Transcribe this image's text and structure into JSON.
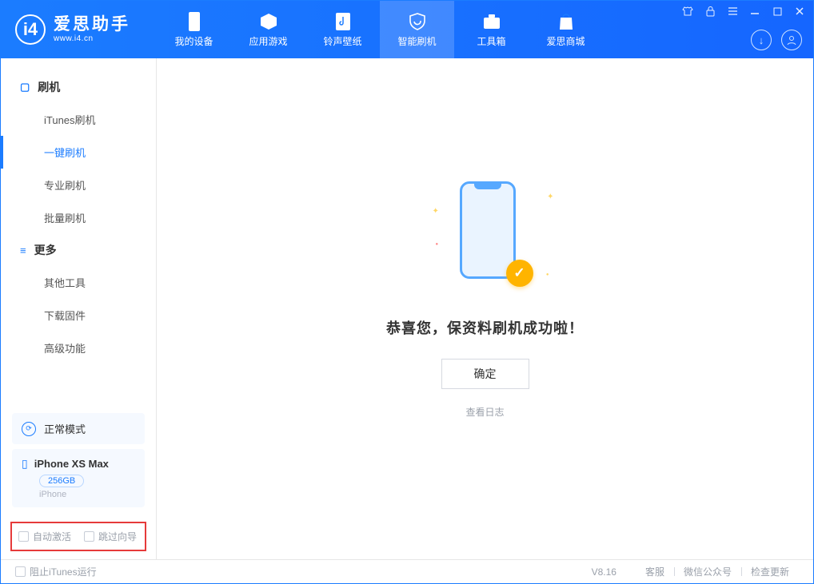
{
  "app": {
    "title": "爱思助手",
    "subtitle": "www.i4.cn"
  },
  "header_tabs": [
    {
      "label": "我的设备"
    },
    {
      "label": "应用游戏"
    },
    {
      "label": "铃声壁纸"
    },
    {
      "label": "智能刷机"
    },
    {
      "label": "工具箱"
    },
    {
      "label": "爱思商城"
    }
  ],
  "sidebar": {
    "group1": {
      "title": "刷机",
      "items": [
        {
          "label": "iTunes刷机"
        },
        {
          "label": "一键刷机"
        },
        {
          "label": "专业刷机"
        },
        {
          "label": "批量刷机"
        }
      ]
    },
    "group2": {
      "title": "更多",
      "items": [
        {
          "label": "其他工具"
        },
        {
          "label": "下载固件"
        },
        {
          "label": "高级功能"
        }
      ]
    }
  },
  "device_mode": {
    "label": "正常模式"
  },
  "device": {
    "name": "iPhone XS Max",
    "storage": "256GB",
    "type": "iPhone"
  },
  "options": {
    "auto_activate": "自动激活",
    "skip_guide": "跳过向导"
  },
  "main": {
    "success_msg": "恭喜您，保资料刷机成功啦！",
    "ok_label": "确定",
    "log_link": "查看日志"
  },
  "footer": {
    "block_itunes": "阻止iTunes运行",
    "version": "V8.16",
    "links": [
      {
        "label": "客服"
      },
      {
        "label": "微信公众号"
      },
      {
        "label": "检查更新"
      }
    ]
  }
}
